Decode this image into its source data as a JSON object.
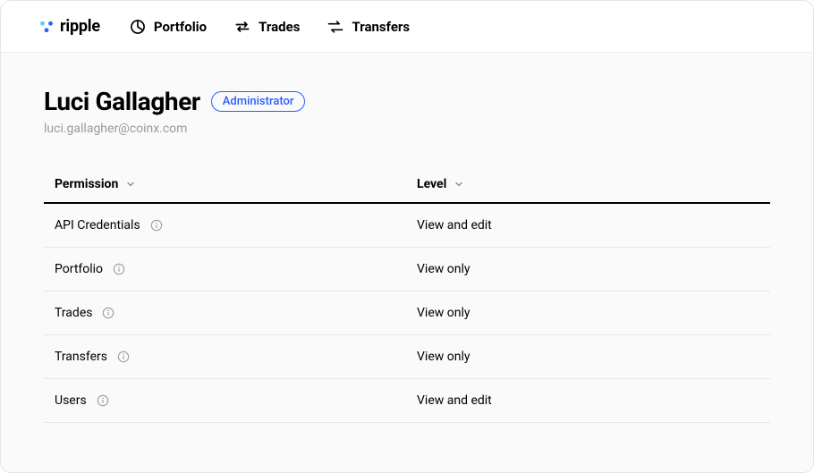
{
  "brand": {
    "name": "ripple"
  },
  "nav": {
    "items": [
      {
        "label": "Portfolio"
      },
      {
        "label": "Trades"
      },
      {
        "label": "Transfers"
      }
    ]
  },
  "user": {
    "name": "Luci Gallagher",
    "role": "Administrator",
    "email": "luci.gallagher@coinx.com"
  },
  "table": {
    "headers": {
      "permission": "Permission",
      "level": "Level"
    },
    "rows": [
      {
        "permission": "API Credentials",
        "level": "View and edit"
      },
      {
        "permission": "Portfolio",
        "level": "View only"
      },
      {
        "permission": "Trades",
        "level": "View only"
      },
      {
        "permission": "Transfers",
        "level": "View only"
      },
      {
        "permission": "Users",
        "level": "View and edit"
      }
    ]
  }
}
